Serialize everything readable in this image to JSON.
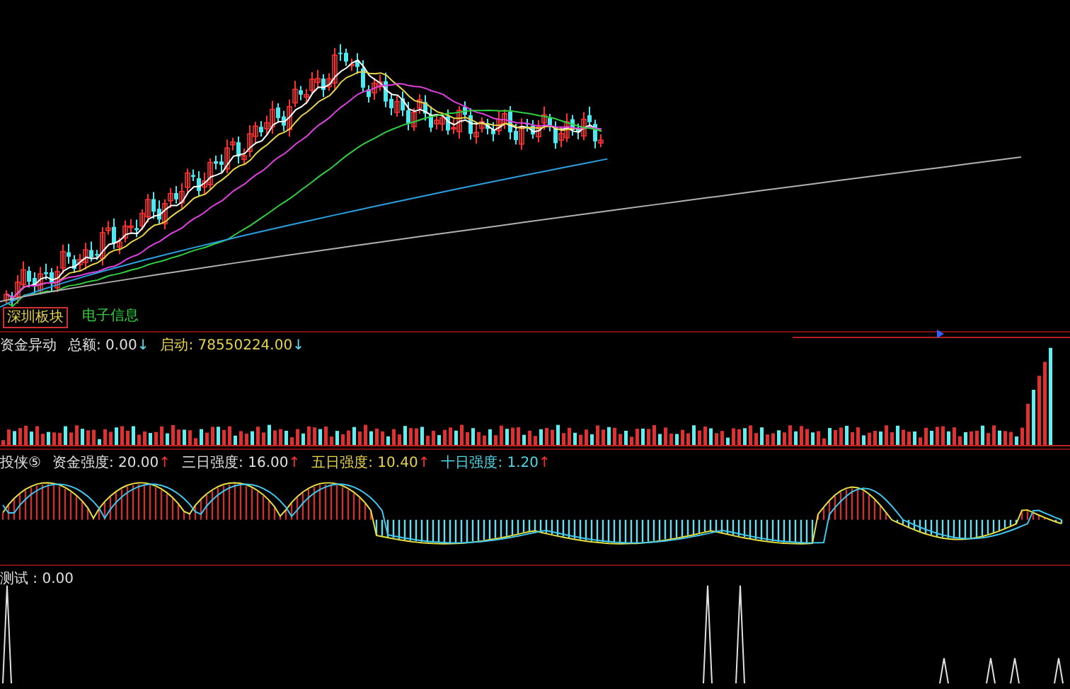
{
  "price_pane": {
    "tags": [
      {
        "text": "深圳板块",
        "kind": "boxed"
      },
      {
        "text": "电子信息",
        "kind": "plain"
      }
    ]
  },
  "fund_pane": {
    "title": "资金异动",
    "readings": [
      {
        "label": "总额: 0.00",
        "color": "#e0e0e0",
        "arrow": {
          "text": "↓",
          "color": "#60e0f0"
        }
      },
      {
        "label": "启动: 78550224.00",
        "color": "#e8d44a",
        "arrow": {
          "text": "↓",
          "color": "#60e0f0"
        }
      }
    ]
  },
  "strength_pane": {
    "title": "投侠⑤",
    "readings": [
      {
        "label": "资金强度: 20.00",
        "color": "#e0e0e0",
        "arrow": {
          "text": "↑",
          "color": "#ff3030"
        }
      },
      {
        "label": "三日强度: 16.00",
        "color": "#e0e0e0",
        "arrow": {
          "text": "↑",
          "color": "#ff3030"
        }
      },
      {
        "label": "五日强度: 10.40",
        "color": "#e8d44a",
        "arrow": {
          "text": "↑",
          "color": "#ff3030"
        }
      },
      {
        "label": "十日强度: 1.20",
        "color": "#4fd8e8",
        "arrow": {
          "text": "↑",
          "color": "#ff3030"
        }
      }
    ]
  },
  "test_pane": {
    "reading": "测试 : 0.00"
  }
}
